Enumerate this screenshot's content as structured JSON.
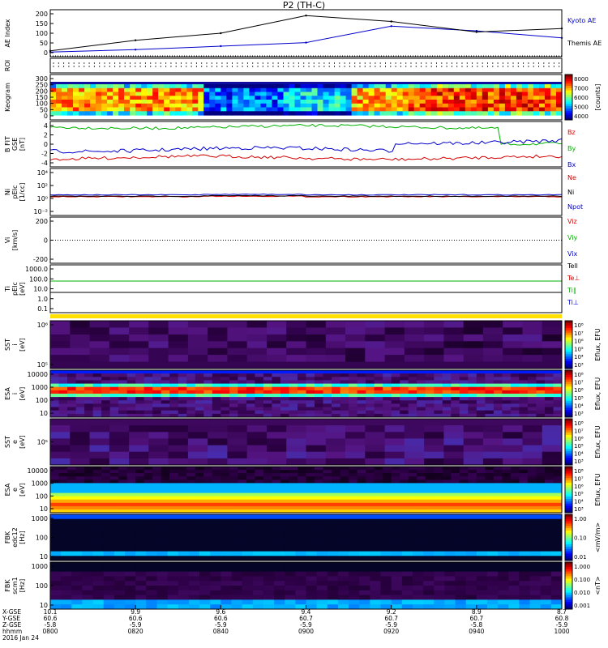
{
  "title": "P2 (TH-C)",
  "colors": {
    "kyoto": "#0000cc",
    "themis": "#000000",
    "red": "#d40000",
    "green": "#00b000",
    "blue": "#0000cc",
    "black": "#000000"
  },
  "panels": [
    {
      "id": "ae",
      "ylabel": [
        "AE Index"
      ],
      "ticks": [
        "200",
        "150",
        "100",
        "50",
        "0"
      ]
    },
    {
      "id": "roi",
      "ylabel": [
        "ROI"
      ],
      "ticks": []
    },
    {
      "id": "keogram",
      "ylabel": [
        "Keogram"
      ],
      "ticks": [
        "300",
        "250",
        "200",
        "150",
        "100",
        "50",
        "0"
      ]
    },
    {
      "id": "bfield",
      "ylabel": [
        "B FIT",
        "GSE",
        "[nT]"
      ],
      "ticks": [
        "4",
        "2",
        "0",
        "-2",
        "-4"
      ]
    },
    {
      "id": "density",
      "ylabel": [
        "Ni",
        "pEIc",
        "[1/cc]"
      ],
      "ticks": [
        "10⁴",
        "10²",
        "10⁰",
        "10⁻²"
      ]
    },
    {
      "id": "velocity",
      "ylabel": [
        "Vi",
        "[km/s]"
      ],
      "ticks": [
        "200",
        "0",
        "-200"
      ]
    },
    {
      "id": "temp",
      "ylabel": [
        "Ti",
        "pEIc",
        "[eV]"
      ],
      "ticks": [
        "1000.0",
        "100.0",
        "10.0",
        "1.0",
        "0.1"
      ]
    },
    {
      "id": "sst_i",
      "ylabel": [
        "SST",
        "i",
        "[eV]"
      ],
      "ticks": [
        "10⁶",
        "10⁵"
      ]
    },
    {
      "id": "esa_i",
      "ylabel": [
        "ESA",
        "i",
        "[eV]"
      ],
      "ticks": [
        "10000",
        "1000",
        "100",
        "10"
      ]
    },
    {
      "id": "sst_e",
      "ylabel": [
        "SST",
        "e",
        "[eV]"
      ],
      "ticks": [
        "10⁵"
      ]
    },
    {
      "id": "esa_e",
      "ylabel": [
        "ESA",
        "e",
        "[eV]"
      ],
      "ticks": [
        "10000",
        "1000",
        "100",
        "10"
      ]
    },
    {
      "id": "fbk_e",
      "ylabel": [
        "FBK",
        "edc12",
        "[Hz]"
      ],
      "ticks": [
        "1000",
        "100",
        "10"
      ]
    },
    {
      "id": "fbk_b",
      "ylabel": [
        "FBK",
        "scm1",
        "[Hz]"
      ],
      "ticks": [
        "1000",
        "100",
        "10"
      ]
    }
  ],
  "legends": {
    "ae": [
      "Kyoto AE",
      "Themis AE"
    ],
    "bfield": [
      "Bz",
      "By",
      "Bx"
    ],
    "density": [
      "Ne",
      "Ni",
      "Npot"
    ],
    "velocity": [
      "Viz",
      "Viy",
      "Vix"
    ],
    "temp": [
      "Tell",
      "Te⊥",
      "Ti∥",
      "Ti⊥"
    ]
  },
  "colorbars": {
    "keogram": {
      "label": "[counts]",
      "ticks": [
        "8000",
        "7000",
        "6000",
        "5000",
        "4000"
      ]
    },
    "sst_i": {
      "label": "Eflux, EFU",
      "ticks": [
        "10⁸",
        "10⁷",
        "10⁶",
        "10⁵",
        "10⁴",
        "10³"
      ]
    },
    "esa_i": {
      "label": "Eflux, EFU",
      "ticks": [
        "10⁸",
        "10⁷",
        "10⁶",
        "10⁵",
        "10⁴",
        "10³"
      ]
    },
    "sst_e": {
      "label": "Eflux, EFU",
      "ticks": [
        "10⁸",
        "10⁷",
        "10⁶",
        "10⁵",
        "10⁴",
        "10³"
      ]
    },
    "esa_e": {
      "label": "Eflux, EFU",
      "ticks": [
        "10⁸",
        "10⁷",
        "10⁶",
        "10⁵",
        "10⁴",
        "10³"
      ]
    },
    "fbk_e": {
      "label": "<mV/m>",
      "ticks": [
        "1.00",
        "0.10",
        "0.01"
      ]
    },
    "fbk_b": {
      "label": "<nT>",
      "ticks": [
        "1.000",
        "0.100",
        "0.010",
        "0.001"
      ]
    }
  },
  "xaxis": {
    "row_labels": [
      "X-GSE",
      "Y-GSE",
      "Z-GSE",
      "hhmm",
      "2016 Jan 24"
    ],
    "columns": [
      {
        "x": "10.1",
        "y": "60.6",
        "z": "-5.8",
        "t": "0800"
      },
      {
        "x": "9.9",
        "y": "60.6",
        "z": "-5.9",
        "t": "0820"
      },
      {
        "x": "9.6",
        "y": "60.6",
        "z": "-5.9",
        "t": "0840"
      },
      {
        "x": "9.4",
        "y": "60.7",
        "z": "-5.9",
        "t": "0900"
      },
      {
        "x": "9.2",
        "y": "60.7",
        "z": "-5.9",
        "t": "0920"
      },
      {
        "x": "8.9",
        "y": "60.7",
        "z": "-5.8",
        "t": "0940"
      },
      {
        "x": "8.7",
        "y": "60.8",
        "z": "-5.9",
        "t": "1000"
      }
    ]
  },
  "chart_data": {
    "type": "line",
    "title": "P2 (TH-C)",
    "x": [
      "0800",
      "0820",
      "0840",
      "0900",
      "0920",
      "0940",
      "1000"
    ],
    "xlabel": "hhmm",
    "series": [
      {
        "name": "Kyoto AE",
        "values": [
          20,
          30,
          45,
          60,
          130,
          110,
          80
        ]
      },
      {
        "name": "Themis AE",
        "values": [
          25,
          70,
          100,
          175,
          150,
          105,
          120
        ]
      }
    ],
    "ylabel": "AE Index",
    "ylim": [
      0,
      200
    ],
    "grid": false,
    "legend": "right"
  }
}
